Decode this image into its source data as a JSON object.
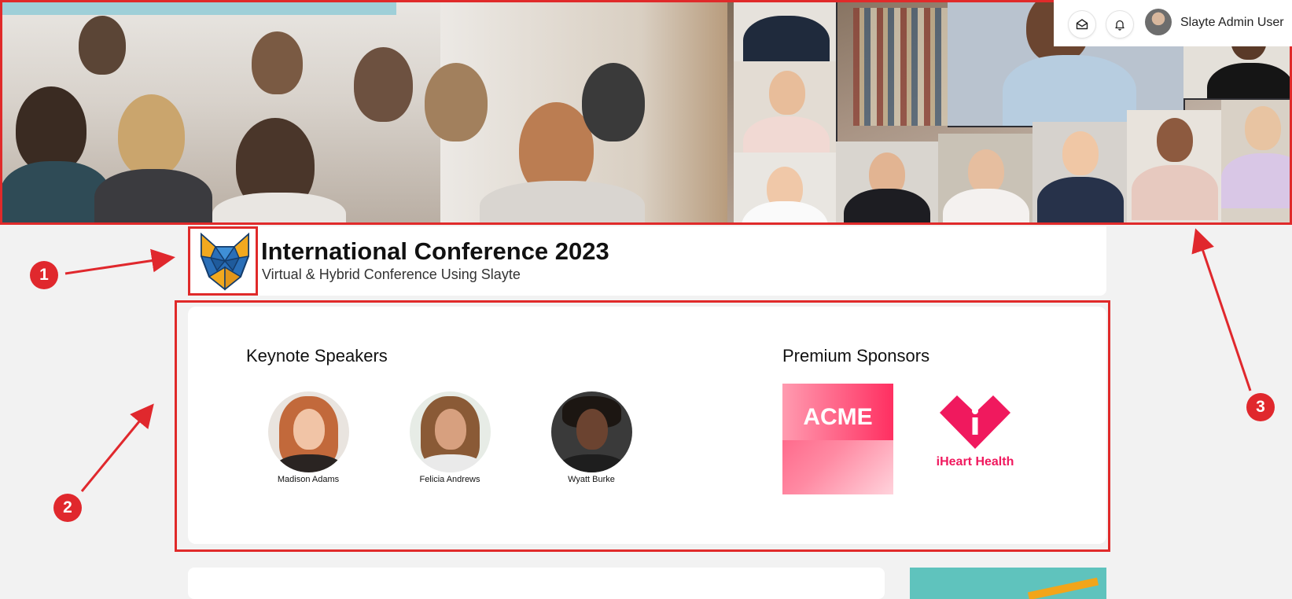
{
  "topbar": {
    "inbox_icon": "envelope-open-icon",
    "bell_icon": "bell-icon",
    "user_name": "Slayte Admin User"
  },
  "event": {
    "title": "International Conference 2023",
    "subtitle": "Virtual & Hybrid Conference Using Slayte",
    "logo_icon": "fox-logo-icon"
  },
  "keynote": {
    "heading": "Keynote Speakers",
    "speakers": [
      {
        "name": "Madison Adams"
      },
      {
        "name": "Felicia Andrews"
      },
      {
        "name": "Wyatt Burke"
      }
    ]
  },
  "sponsors": {
    "heading": "Premium Sponsors",
    "items": [
      {
        "name": "ACME"
      },
      {
        "name": "iHeart Health"
      }
    ]
  },
  "annotations": {
    "markers": [
      "1",
      "2",
      "3"
    ],
    "color": "#e0282d"
  },
  "colors": {
    "accent_pink": "#f0195e",
    "teal": "#5fc3bd"
  }
}
